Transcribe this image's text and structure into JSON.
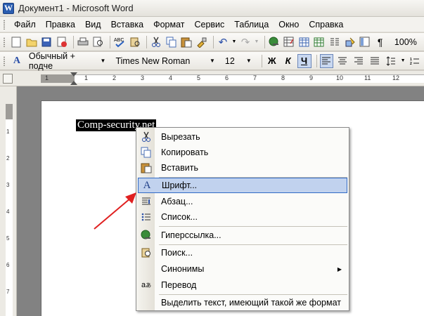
{
  "window": {
    "title": "Документ1 - Microsoft Word",
    "logo": "W"
  },
  "menu": [
    "Файл",
    "Правка",
    "Вид",
    "Вставка",
    "Формат",
    "Сервис",
    "Таблица",
    "Окно",
    "Справка"
  ],
  "toolbar2": {
    "style": "Обычный + подче",
    "font": "Times New Roman",
    "size": "12",
    "bold": "Ж",
    "italic": "К",
    "underline": "Ч",
    "zoom": "100%"
  },
  "document": {
    "selected_text": "Comp-security.net"
  },
  "context_menu": {
    "items": [
      {
        "label": "Вырезать",
        "icon": "scissors-icon"
      },
      {
        "label": "Копировать",
        "icon": "copy-icon"
      },
      {
        "label": "Вставить",
        "icon": "paste-icon"
      },
      {
        "label": "Шрифт...",
        "icon": "font-icon",
        "highlighted": true
      },
      {
        "label": "Абзац...",
        "icon": "paragraph-icon"
      },
      {
        "label": "Список...",
        "icon": "list-icon"
      },
      {
        "label": "Гиперссылка...",
        "icon": "hyperlink-icon"
      },
      {
        "label": "Поиск...",
        "icon": "search-icon"
      },
      {
        "label": "Синонимы",
        "icon": "",
        "submenu": true
      },
      {
        "label": "Перевод",
        "icon": "translate-icon"
      },
      {
        "label": "Выделить текст, имеющий такой же формат",
        "icon": ""
      }
    ]
  },
  "colors": {
    "highlight": "#c1d2ee",
    "highlight_border": "#316ac5",
    "arrow": "#e02020"
  }
}
